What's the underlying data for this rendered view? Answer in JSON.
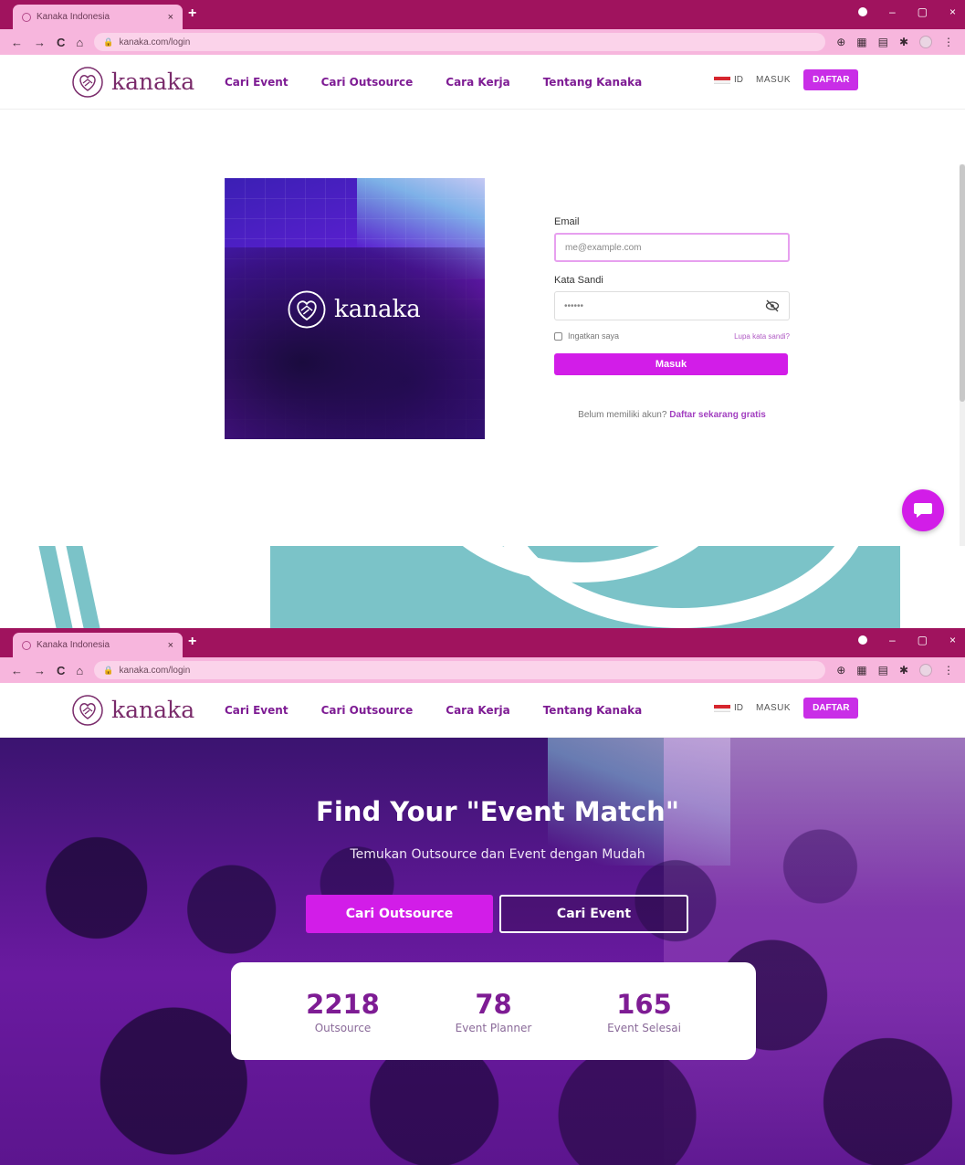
{
  "browser": {
    "tab_title": "Kanaka Indonesia",
    "tab_close": "×",
    "new_tab": "+",
    "url": "kanaka.com/login",
    "back": "←",
    "forward": "→",
    "reload": "C",
    "home": "⌂",
    "window_controls": [
      "–",
      "▢",
      "×"
    ]
  },
  "header": {
    "logo_text": "kanaka",
    "nav": [
      "Cari Event",
      "Cari Outsource",
      "Cara Kerja",
      "Tentang Kanaka"
    ],
    "lang": "ID",
    "login_link": "MASUK",
    "register_button": "DAFTAR"
  },
  "login": {
    "image_logo_text": "kanaka",
    "email_label": "Email",
    "email_placeholder": "me@example.com",
    "password_label": "Kata Sandi",
    "password_value": "••••••",
    "remember_label": "Ingatkan saya",
    "forgot_link": "Lupa kata sandi?",
    "submit_button": "Masuk",
    "signup_text": "Belum memiliki akun?",
    "signup_link": "Daftar sekarang gratis"
  },
  "landing": {
    "headline": "Find Your \"Event Match\"",
    "subtitle": "Temukan Outsource dan Event dengan Mudah",
    "primary_cta": "Cari Outsource",
    "secondary_cta": "Cari Event",
    "stats": [
      {
        "value": "2218",
        "label": "Outsource"
      },
      {
        "value": "78",
        "label": "Event Planner"
      },
      {
        "value": "165",
        "label": "Event Selesai"
      }
    ]
  },
  "colors": {
    "brand": "#7e1c94",
    "accent": "#d21de8",
    "tabbar": "#a0135e",
    "toolbar": "#f7b6dd",
    "deco": "#7bc3c8"
  },
  "icons": [
    "heart-logo-icon",
    "eye-off-icon",
    "chat-icon",
    "lock-icon",
    "flag-id-icon"
  ]
}
